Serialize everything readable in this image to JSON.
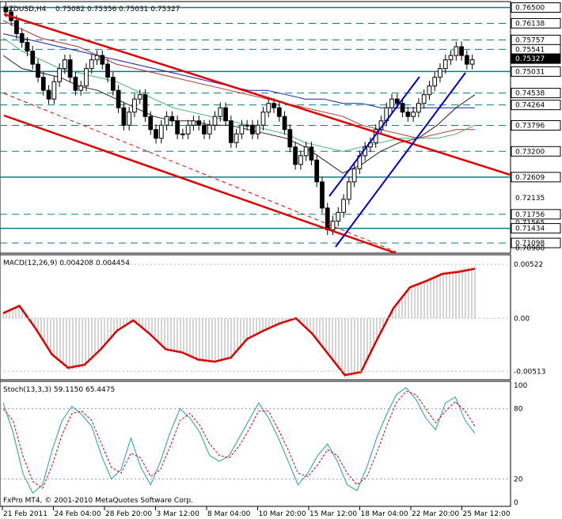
{
  "header": {
    "symbol_tf": "NZDUSD,H4",
    "ohlc": "0.75082 0.75356 0.75031 0.75327"
  },
  "copyright": "FxPro MT4, © 2001-2010 MetaQuotes Software Corp.",
  "colors": {
    "candle": "#000000",
    "teal_lines": "#008080",
    "red_channel": "#e00000",
    "blue_channel": "#0000cc",
    "macd_signal": "#dd0000",
    "macd_hist": "#aaaaaa",
    "stoch_main": "#20a0a0",
    "stoch_signal": "#dd0000",
    "current_price_tag": "#000000"
  },
  "chart_data": [
    {
      "type": "candlestick",
      "symbol": "NZDUSD",
      "timeframe": "H4",
      "ylim": [
        0.709,
        0.766
      ],
      "x_tick_labels": [
        "21 Feb 2011",
        "24 Feb 04:00",
        "28 Feb 20:00",
        "3 Mar 12:00",
        "8 Mar 04:00",
        "10 Mar 20:00",
        "15 Mar 12:00",
        "18 Mar 04:00",
        "22 Mar 20:00",
        "25 Mar 12:00"
      ],
      "price_labels": [
        {
          "text": "0.76500",
          "value": 0.765,
          "boxed": true
        },
        {
          "text": "0.76138",
          "value": 0.76138,
          "boxed": true
        },
        {
          "text": "0.75757",
          "value": 0.75757,
          "boxed": true
        },
        {
          "text": "0.75541",
          "value": 0.75541,
          "boxed": true
        },
        {
          "text": "0.75327",
          "value": 0.75327,
          "boxed": true,
          "current": true
        },
        {
          "text": "0.75031",
          "value": 0.75031,
          "boxed": true
        },
        {
          "text": "0.74538",
          "value": 0.74538,
          "boxed": true
        },
        {
          "text": "0.74264",
          "value": 0.74264,
          "boxed": true
        },
        {
          "text": "0.73796",
          "value": 0.73796,
          "boxed": true
        },
        {
          "text": "0.73200",
          "value": 0.732,
          "boxed": true
        },
        {
          "text": "0.72609",
          "value": 0.72609,
          "boxed": true
        },
        {
          "text": "0.72135",
          "value": 0.72135,
          "boxed": false
        },
        {
          "text": "0.71756",
          "value": 0.71756,
          "boxed": true
        },
        {
          "text": "0.71565",
          "value": 0.71565,
          "boxed": false
        },
        {
          "text": "0.71434",
          "value": 0.71434,
          "boxed": true
        },
        {
          "text": "0.71098",
          "value": 0.71098,
          "boxed": true
        },
        {
          "text": "0.70980",
          "value": 0.7098,
          "boxed": false
        }
      ],
      "solid_levels": [
        0.765,
        0.75031,
        0.72609,
        0.71434
      ],
      "dashed_levels": [
        0.76138,
        0.75757,
        0.75541,
        0.74538,
        0.74264,
        0.73796,
        0.732,
        0.71756,
        0.71098
      ],
      "close_series": [
        0.764,
        0.762,
        0.759,
        0.757,
        0.755,
        0.752,
        0.749,
        0.746,
        0.744,
        0.748,
        0.751,
        0.753,
        0.749,
        0.746,
        0.747,
        0.751,
        0.753,
        0.754,
        0.752,
        0.749,
        0.746,
        0.742,
        0.738,
        0.741,
        0.744,
        0.745,
        0.74,
        0.737,
        0.735,
        0.738,
        0.74,
        0.739,
        0.736,
        0.736,
        0.738,
        0.739,
        0.738,
        0.736,
        0.738,
        0.74,
        0.742,
        0.739,
        0.734,
        0.736,
        0.738,
        0.738,
        0.736,
        0.738,
        0.741,
        0.743,
        0.742,
        0.74,
        0.737,
        0.733,
        0.729,
        0.731,
        0.733,
        0.73,
        0.725,
        0.719,
        0.714,
        0.716,
        0.718,
        0.721,
        0.725,
        0.728,
        0.731,
        0.733,
        0.734,
        0.737,
        0.739,
        0.742,
        0.744,
        0.743,
        0.741,
        0.74,
        0.741,
        0.743,
        0.745,
        0.747,
        0.749,
        0.751,
        0.753,
        0.754,
        0.756,
        0.754,
        0.752,
        0.753
      ],
      "ma_red": [
        0.762,
        0.76,
        0.758,
        0.757,
        0.756,
        0.754,
        0.752,
        0.751,
        0.75,
        0.749,
        0.748,
        0.747,
        0.746,
        0.745,
        0.744,
        0.743,
        0.742,
        0.741,
        0.74,
        0.738,
        0.737,
        0.736,
        0.735,
        0.736,
        0.737,
        0.737
      ],
      "ma_blue": [
        0.759,
        0.758,
        0.757,
        0.756,
        0.755,
        0.754,
        0.753,
        0.752,
        0.751,
        0.75,
        0.749,
        0.748,
        0.747,
        0.746,
        0.746,
        0.745,
        0.744,
        0.744,
        0.743,
        0.743,
        0.742,
        0.742,
        0.742,
        0.742,
        0.742,
        0.742
      ],
      "ma_green": [
        0.758,
        0.755,
        0.753,
        0.751,
        0.75,
        0.749,
        0.748,
        0.746,
        0.744,
        0.742,
        0.741,
        0.74,
        0.739,
        0.738,
        0.737,
        0.736,
        0.734,
        0.733,
        0.732,
        0.733,
        0.734,
        0.735,
        0.735,
        0.735,
        0.736,
        0.738
      ],
      "ma_black": [
        0.754,
        0.751,
        0.75,
        0.749,
        0.747,
        0.746,
        0.744,
        0.742,
        0.74,
        0.739,
        0.739,
        0.738,
        0.738,
        0.737,
        0.736,
        0.735,
        0.733,
        0.73,
        0.727,
        0.729,
        0.732,
        0.734,
        0.735,
        0.738,
        0.742,
        0.745
      ]
    },
    {
      "type": "line",
      "title": "MACD(12,26,9) 0.004208 0.004454",
      "ylim": [
        -0.0058,
        0.006
      ],
      "y_tick_labels": [
        {
          "text": "0.00522",
          "value": 0.00522
        },
        {
          "text": "0.00",
          "value": 0.0
        },
        {
          "text": "-0.00513",
          "value": -0.00513
        }
      ],
      "series": [
        {
          "values": [
            0.0005,
            0.0012,
            -0.001,
            -0.0035,
            -0.0048,
            -0.0045,
            -0.003,
            -0.0012,
            -0.0002,
            -0.0015,
            -0.003,
            -0.0033,
            -0.004,
            -0.0042,
            -0.0038,
            -0.002,
            -0.0012,
            -0.0005,
            0.0,
            -0.0015,
            -0.0035,
            -0.0055,
            -0.0052,
            -0.002,
            0.001,
            0.003,
            0.0036,
            0.0043,
            0.0045,
            0.0048
          ]
        }
      ]
    },
    {
      "type": "line",
      "title": "Stoch(13,3,3) 59.1150 65.4475",
      "ylim": [
        0,
        100
      ],
      "y_tick_labels": [
        {
          "text": "100",
          "value": 100
        },
        {
          "text": "80",
          "value": 80
        },
        {
          "text": "20",
          "value": 20
        },
        {
          "text": "0",
          "value": 0
        }
      ],
      "series": [
        {
          "values": [
            85,
            60,
            25,
            8,
            15,
            45,
            70,
            82,
            75,
            65,
            40,
            20,
            28,
            55,
            30,
            15,
            35,
            60,
            80,
            72,
            60,
            40,
            35,
            40,
            55,
            70,
            85,
            72,
            55,
            35,
            15,
            25,
            40,
            50,
            35,
            15,
            10,
            30,
            55,
            75,
            92,
            98,
            88,
            72,
            62,
            85,
            90,
            70,
            59
          ]
        },
        {
          "values": [
            80,
            70,
            40,
            18,
            12,
            32,
            58,
            76,
            78,
            70,
            50,
            30,
            25,
            42,
            38,
            22,
            28,
            48,
            70,
            76,
            66,
            50,
            40,
            38,
            48,
            62,
            78,
            78,
            62,
            45,
            25,
            22,
            32,
            45,
            40,
            25,
            15,
            22,
            42,
            65,
            85,
            95,
            92,
            80,
            68,
            78,
            86,
            78,
            65
          ]
        }
      ]
    }
  ]
}
